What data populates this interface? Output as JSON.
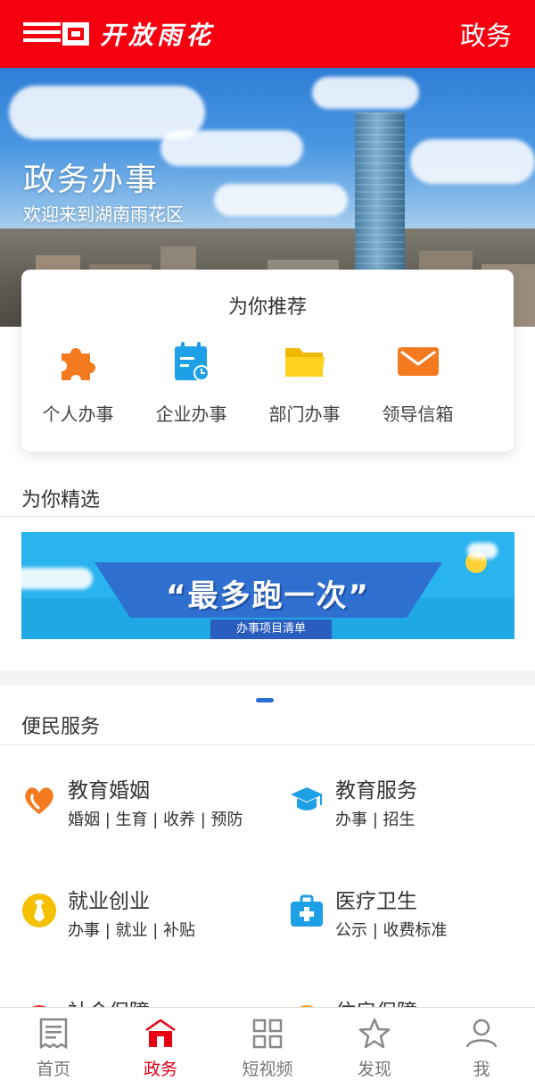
{
  "header": {
    "brand_text": "开放雨花",
    "right_label": "政务"
  },
  "hero": {
    "title": "政务办事",
    "subtitle": "欢迎来到湖南雨花区"
  },
  "recommend": {
    "title": "为你推荐",
    "items": [
      {
        "label": "个人办事",
        "icon": "puzzle-icon"
      },
      {
        "label": "企业办事",
        "icon": "calendar-clock-icon"
      },
      {
        "label": "部门办事",
        "icon": "folder-icon"
      },
      {
        "label": "领导信箱",
        "icon": "mail-icon"
      }
    ]
  },
  "featured": {
    "title": "为你精选",
    "banner_text": "“最多跑一次”",
    "banner_sub": "办事项目清单"
  },
  "services": {
    "title": "便民服务",
    "items": [
      {
        "title": "教育婚姻",
        "sub": "婚姻 | 生育 | 收养 | 预防",
        "icon": "heart-icon"
      },
      {
        "title": "教育服务",
        "sub": "办事 | 招生",
        "icon": "graduation-cap-icon"
      },
      {
        "title": "就业创业",
        "sub": "办事 | 就业 | 补贴",
        "icon": "tie-icon"
      },
      {
        "title": "医疗卫生",
        "sub": "公示 | 收费标准",
        "icon": "medical-kit-icon"
      },
      {
        "title": "社会保障",
        "sub": "",
        "icon": "shield-icon"
      },
      {
        "title": "住房保障",
        "sub": "",
        "icon": "house-icon"
      }
    ]
  },
  "tabs": [
    {
      "label": "首页",
      "icon": "newspaper-icon",
      "active": false
    },
    {
      "label": "政务",
      "icon": "government-icon",
      "active": true
    },
    {
      "label": "短视频",
      "icon": "grid-icon",
      "active": false
    },
    {
      "label": "发现",
      "icon": "star-icon",
      "active": false
    },
    {
      "label": "我",
      "icon": "user-icon",
      "active": false
    }
  ],
  "colors": {
    "brand_red": "#f5000e",
    "tab_active": "#e60012",
    "accent_blue": "#2b6fd6"
  }
}
